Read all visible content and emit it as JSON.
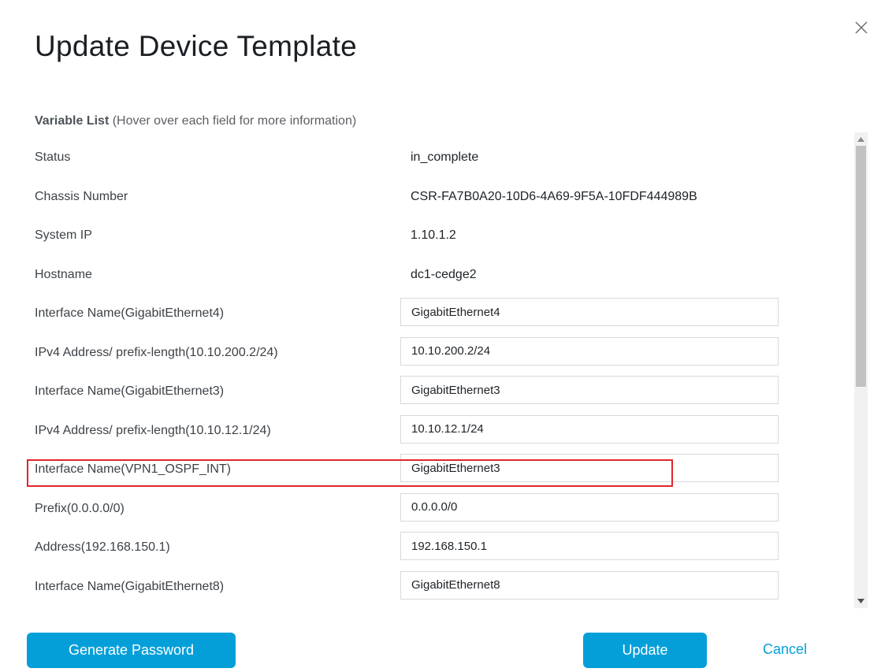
{
  "dialog": {
    "title": "Update Device Template",
    "section_title": "Variable List",
    "section_hint": "(Hover over each field for more information)"
  },
  "static_rows": [
    {
      "label": "Status",
      "value": "in_complete"
    },
    {
      "label": "Chassis Number",
      "value": "CSR-FA7B0A20-10D6-4A69-9F5A-10FDF444989B"
    },
    {
      "label": "System IP",
      "value": "1.10.1.2"
    },
    {
      "label": "Hostname",
      "value": "dc1-cedge2"
    }
  ],
  "input_rows": [
    {
      "label": "Interface Name(GigabitEthernet4)",
      "value": "GigabitEthernet4"
    },
    {
      "label": "IPv4 Address/ prefix-length(10.10.200.2/24)",
      "value": "10.10.200.2/24"
    },
    {
      "label": "Interface Name(GigabitEthernet3)",
      "value": "GigabitEthernet3"
    },
    {
      "label": "IPv4 Address/ prefix-length(10.10.12.1/24)",
      "value": "10.10.12.1/24"
    },
    {
      "label": "Interface Name(VPN1_OSPF_INT)",
      "value": "GigabitEthernet3"
    },
    {
      "label": "Prefix(0.0.0.0/0)",
      "value": "0.0.0.0/0"
    },
    {
      "label": "Address(192.168.150.1)",
      "value": "192.168.150.1"
    },
    {
      "label": "Interface Name(GigabitEthernet8)",
      "value": "GigabitEthernet8"
    }
  ],
  "buttons": {
    "generate_password": "Generate Password",
    "update": "Update",
    "cancel": "Cancel"
  },
  "colors": {
    "accent": "#049fd9",
    "highlight": "#e0262c"
  }
}
